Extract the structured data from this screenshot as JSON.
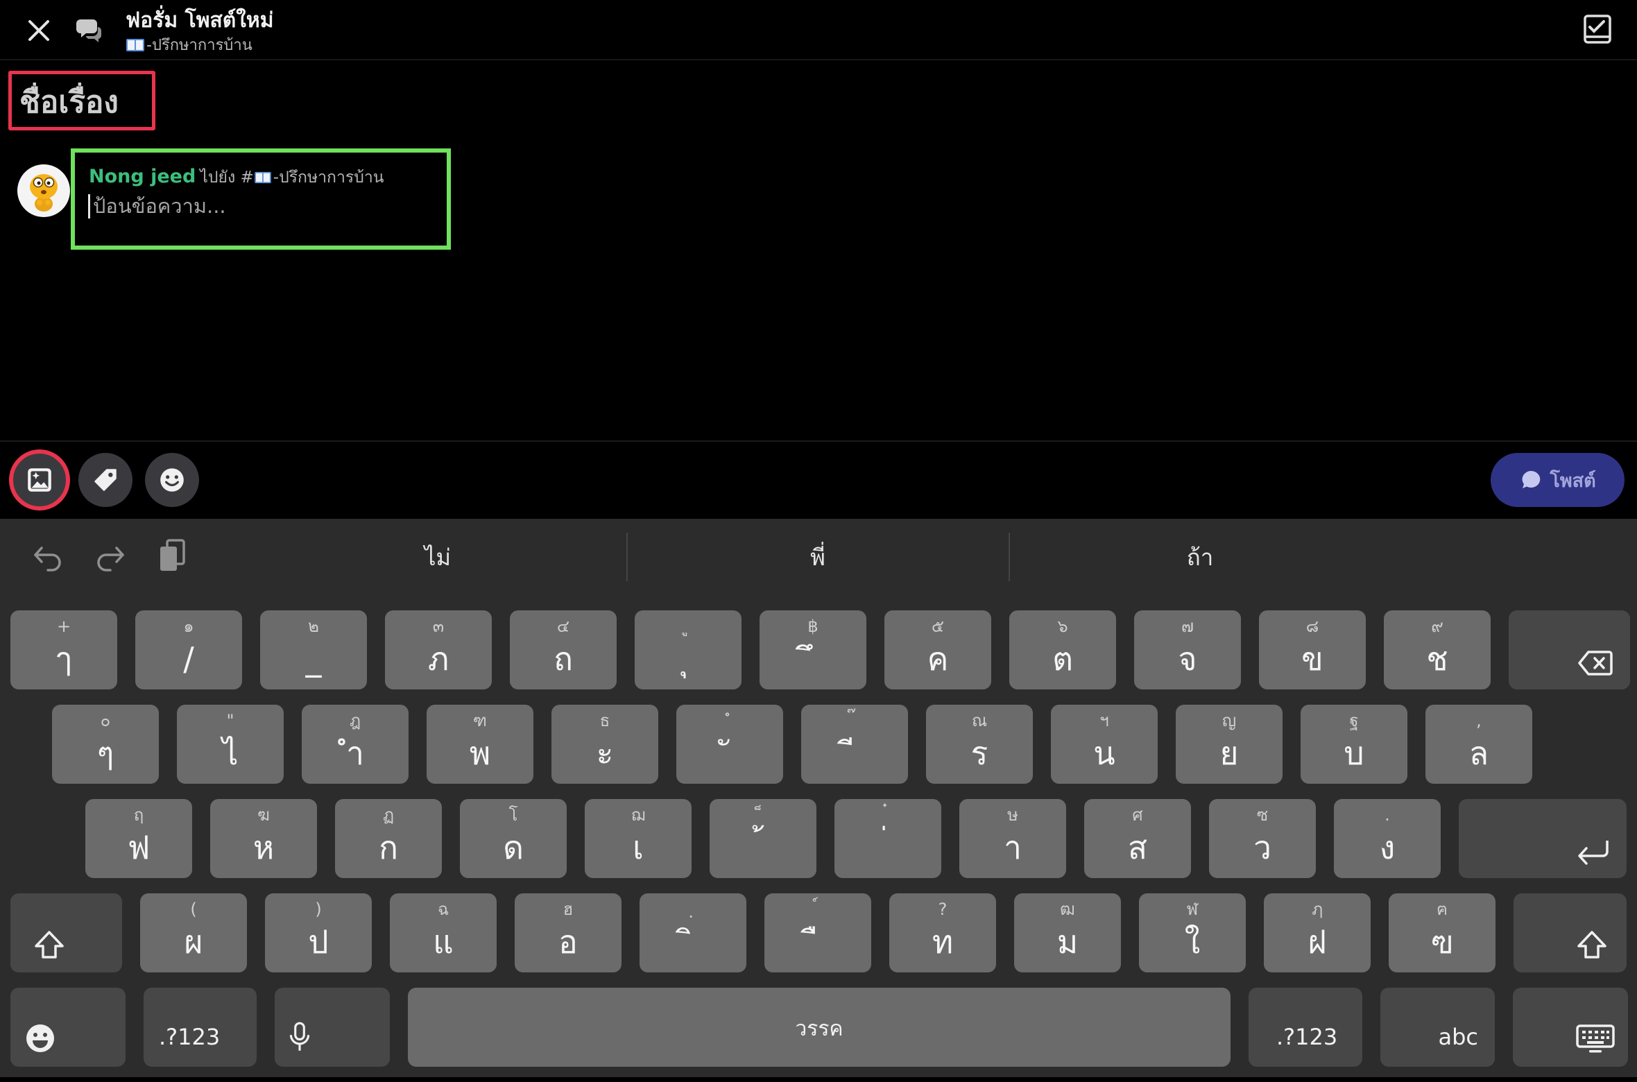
{
  "header": {
    "title": "ฟอรั่ม โพสต์ใหม่",
    "channel_icon": "book-icon",
    "channel_name": "-ปรึกษาการบ้าน"
  },
  "post": {
    "title_placeholder": "ชื่อเรื่อง",
    "author": "Nong jeed",
    "destination_prefix": "ไปยัง #",
    "destination_icon": "book-icon",
    "destination_channel": "-ปรึกษาการบ้าน",
    "message_placeholder": "ป้อนข้อความ..."
  },
  "toolbar": {
    "icons": [
      "image-icon",
      "tag-icon",
      "emoji-icon"
    ],
    "post_icon": "chat-bubble-icon",
    "post_label": "โพสต์"
  },
  "keyboard": {
    "toolbar_icons": [
      "undo-icon",
      "redo-icon",
      "clipboard-icon"
    ],
    "suggestions": [
      "ไม่",
      "พี่",
      "ถ้า"
    ],
    "rows": [
      {
        "keys": [
          {
            "top": "+",
            "main": "ๅ"
          },
          {
            "top": "๑",
            "main": "/"
          },
          {
            "top": "๒",
            "main": "_"
          },
          {
            "top": "๓",
            "main": "ภ"
          },
          {
            "top": "๔",
            "main": "ถ"
          },
          {
            "top": "ู",
            "main": "ุ"
          },
          {
            "top": "฿",
            "main": "ึ"
          },
          {
            "top": "๕",
            "main": "ค"
          },
          {
            "top": "๖",
            "main": "ต"
          },
          {
            "top": "๗",
            "main": "จ"
          },
          {
            "top": "๘",
            "main": "ข"
          },
          {
            "top": "๙",
            "main": "ช"
          }
        ]
      },
      {
        "keys": [
          {
            "top": "๐",
            "main": "ๆ"
          },
          {
            "top": "\"",
            "main": "ไ"
          },
          {
            "top": "ฎ",
            "main": "ำ"
          },
          {
            "top": "ฑ",
            "main": "พ"
          },
          {
            "top": "ธ",
            "main": "ะ"
          },
          {
            "top": "ํ",
            "main": "ั"
          },
          {
            "top": "๊",
            "main": "ี"
          },
          {
            "top": "ณ",
            "main": "ร"
          },
          {
            "top": "ฯ",
            "main": "น"
          },
          {
            "top": "ญ",
            "main": "ย"
          },
          {
            "top": "ฐ",
            "main": "บ"
          },
          {
            "top": ",",
            "main": "ล"
          }
        ]
      },
      {
        "keys": [
          {
            "top": "ฤ",
            "main": "ฟ"
          },
          {
            "top": "ฆ",
            "main": "ห"
          },
          {
            "top": "ฏ",
            "main": "ก"
          },
          {
            "top": "โ",
            "main": "ด"
          },
          {
            "top": "ฌ",
            "main": "เ"
          },
          {
            "top": "็",
            "main": "้"
          },
          {
            "top": "๋",
            "main": "่"
          },
          {
            "top": "ษ",
            "main": "า"
          },
          {
            "top": "ศ",
            "main": "ส"
          },
          {
            "top": "ซ",
            "main": "ว"
          },
          {
            "top": ".",
            "main": "ง"
          }
        ]
      },
      {
        "keys": [
          {
            "top": "(",
            "main": "ผ"
          },
          {
            "top": ")",
            "main": "ป"
          },
          {
            "top": "ฉ",
            "main": "แ"
          },
          {
            "top": "ฮ",
            "main": "อ"
          },
          {
            "top": "ฺ",
            "main": "ิ"
          },
          {
            "top": "์",
            "main": "ื"
          },
          {
            "top": "?",
            "main": "ท"
          },
          {
            "top": "ฒ",
            "main": "ม"
          },
          {
            "top": "ฬ",
            "main": "ใ"
          },
          {
            "top": "ฦ",
            "main": "ฝ"
          },
          {
            "top": "ฅ",
            "main": "ฃ"
          }
        ]
      }
    ],
    "special_icons": [
      "backspace-icon",
      "enter-icon",
      "shift-icon",
      "emoji-icon",
      "mic-icon",
      "keyboard-icon"
    ],
    "bottom": {
      "symbols_left": ".?123",
      "space": "วรรค",
      "symbols_right": ".?123",
      "abc": "abc"
    }
  },
  "colors": {
    "author_name": "#3cbf7c",
    "annotation_red": "#e8344e",
    "annotation_green": "#6fe15c",
    "post_button": "#2f3385",
    "keyboard_bg": "#2c2c2c",
    "key_bg": "#6b6b6b",
    "special_key_bg": "#474747"
  }
}
